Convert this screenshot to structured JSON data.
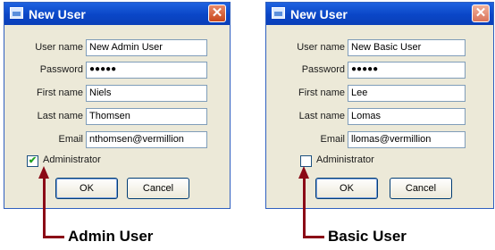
{
  "dialogs": [
    {
      "title": "New User",
      "fields": [
        {
          "label": "User name",
          "value": "New Admin User"
        },
        {
          "label": "Password",
          "value": "●●●●●"
        },
        {
          "label": "First name",
          "value": "Niels"
        },
        {
          "label": "Last name",
          "value": "Thomsen"
        },
        {
          "label": "Email",
          "value": "nthomsen@vermillion"
        }
      ],
      "admin_label": "Administrator",
      "admin_checked": true,
      "ok_label": "OK",
      "cancel_label": "Cancel",
      "check_mark": "✔",
      "close_symbol": "✕"
    },
    {
      "title": "New User",
      "fields": [
        {
          "label": "User name",
          "value": "New Basic User"
        },
        {
          "label": "Password",
          "value": "●●●●●"
        },
        {
          "label": "First name",
          "value": "Lee"
        },
        {
          "label": "Last name",
          "value": "Lomas"
        },
        {
          "label": "Email",
          "value": "llomas@vermillion"
        }
      ],
      "admin_label": "Administrator",
      "admin_checked": false,
      "ok_label": "OK",
      "cancel_label": "Cancel",
      "close_symbol": "✕"
    }
  ],
  "callouts": {
    "admin": "Admin User",
    "basic": "Basic User"
  },
  "colors": {
    "titlebar": "#0a46c7",
    "dialog_bg": "#ece9d8",
    "arrow": "#8b0a16",
    "check": "#21a121"
  }
}
